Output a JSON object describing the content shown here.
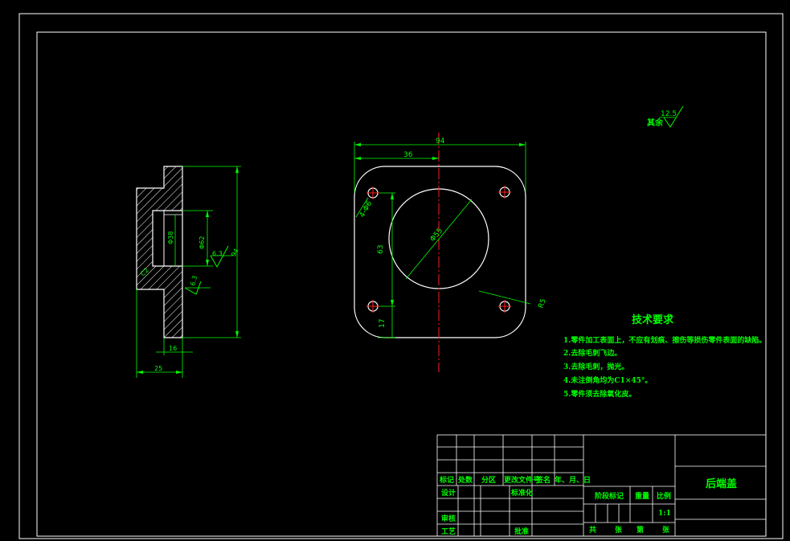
{
  "title_block": {
    "part_name": "后端盖",
    "hdr_mark": "标记",
    "hdr_count": "处数",
    "hdr_zone": "分区",
    "hdr_change_doc": "更改文件号",
    "hdr_sign": "签名",
    "hdr_date": "年、月、日",
    "design": "设计",
    "standardize": "标准化",
    "review": "审核",
    "process": "工艺",
    "approve": "批准",
    "stage_mark": "阶段标记",
    "weight": "重量",
    "scale_label": "比例",
    "scale_value": "1:1",
    "total": "共",
    "sheets": "张",
    "number": "第",
    "sheet": "张"
  },
  "roughness": {
    "other_label": "其余",
    "other_value": "12.5",
    "face_value_1": "6.3",
    "face_value_2": "6.3"
  },
  "tech_requirements": {
    "title": "技术要求",
    "items": [
      "1.零件加工表面上，不应有划痕、擦伤等损伤零件表面的缺陷。",
      "2.去除毛刺飞边。",
      "3.去除毛刺，抛光。",
      "4.未注倒角均为C1×45°。",
      "5.零件须去除氧化皮。"
    ]
  },
  "front_view": {
    "dim_width": "94",
    "dim_hole_x": "36",
    "dim_hole_y": "63",
    "dim_edge": "17",
    "dim_diameter": "Φ55",
    "dim_hole": "4-Φ6",
    "dim_radius": "R5"
  },
  "side_view": {
    "dim_thickness": "16",
    "dim_total": "25",
    "dim_bore": "Φ38",
    "dim_boss": "Φ62",
    "dim_height": "94",
    "dim_chamfer": "C2"
  }
}
